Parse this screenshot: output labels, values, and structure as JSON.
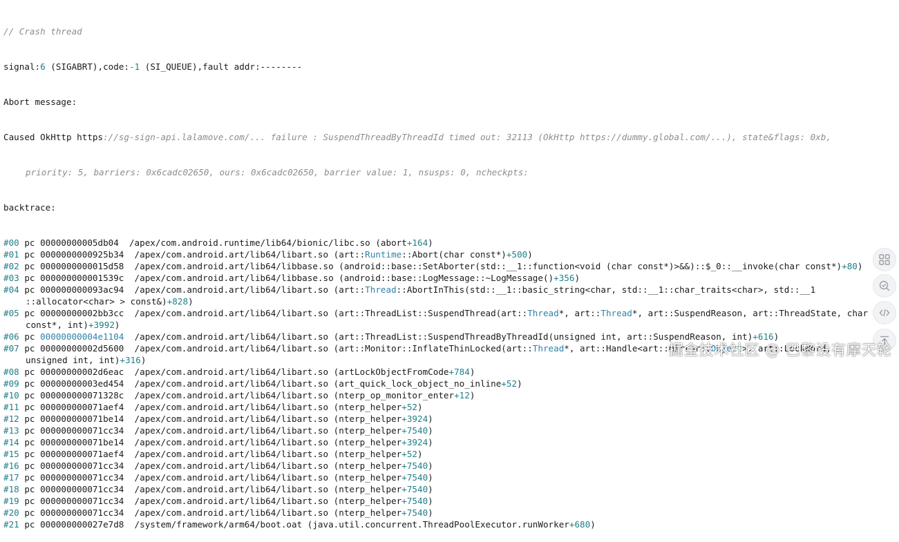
{
  "header": {
    "comment": "// Crash thread",
    "signal_prefix": "signal:",
    "signal_num": "6",
    "signal_mid": " (SIGABRT),code:",
    "code_num": "-1",
    "signal_tail": " (SI_QUEUE),fault addr:--------",
    "abort_message": "Abort message:",
    "caused_prefix": "Caused OkHttp https",
    "caused_detail_1": "://sg-sign-api.lalamove.com/... failure : SuspendThreadByThreadId timed out: 32113 (OkHttp https://dummy.global.com/...), state&flags: 0xb,",
    "caused_detail_2": "priority: 5, barriers: 0x6cadc02650, ours: 0x6cadc02650, barrier value: 1, nsusps: 0, ncheckpts:",
    "backtrace_label": "backtrace:"
  },
  "frames": [
    {
      "idx": "#00",
      "pc": " pc 00000000005db04  /apex/com.android.runtime/lib64/bionic/libc.so (abort",
      "off": "+164",
      "close": ")"
    },
    {
      "idx": "#01",
      "pc": " pc 0000000000925b34  /apex/com.android.art/lib64/libart.so (art::",
      "sym1": "Runtime",
      "mid": "::Abort(char const*)",
      "off": "+500",
      "close": ")"
    },
    {
      "idx": "#02",
      "pc": " pc 0000000000015d58  /apex/com.android.art/lib64/libbase.so (android::base::SetAborter(std::__1::function<void (char const*)>&&)::$_0::__invoke(char const*)",
      "off": "+80",
      "close": ")"
    },
    {
      "idx": "#03",
      "pc": " pc 000000000001539c  /apex/com.android.art/lib64/libbase.so (android::base::LogMessage::~LogMessage()",
      "off": "+356",
      "close": ")"
    },
    {
      "idx": "#04",
      "pc": " pc 000000000093ac94  /apex/com.android.art/lib64/libart.so (art::",
      "sym1": "Thread",
      "mid": "::AbortInThis(std::__1::basic_string<char, std::__1::char_traits<char>, std::__1",
      "cont": "::allocator<char> > const&)",
      "off": "+828",
      "close": ")"
    },
    {
      "idx": "#05",
      "pc": " pc 00000000002bb3cc  /apex/com.android.art/lib64/libart.so (art::ThreadList::SuspendThread(art::",
      "sym1": "Thread",
      "mid": "*, art::",
      "sym2": "Thread",
      "mid2": "*, art::SuspendReason, art::ThreadState, char",
      "cont": "const*, int)",
      "off": "+3992",
      "close": ")"
    },
    {
      "idx": "#06",
      "pcp": " pc ",
      "pcaddr": "00000000004e1104",
      "pc": "  /apex/com.android.art/lib64/libart.so (art::ThreadList::SuspendThreadByThreadId(unsigned int, art::SuspendReason, int)",
      "off": "+616",
      "close": ")"
    },
    {
      "idx": "#07",
      "pc": " pc 00000000002d5600  /apex/com.android.art/lib64/libart.so (art::Monitor::InflateThinLocked(art::",
      "sym1": "Thread",
      "mid": "*, art::Handle<art::mirror::",
      "sym2": "Object",
      "mid2": ">, art::LockWord,",
      "cont": "unsigned int, int)",
      "off": "+316",
      "close": ")"
    },
    {
      "idx": "#08",
      "pc": " pc 00000000002d6eac  /apex/com.android.art/lib64/libart.so (artLockObjectFromCode",
      "off": "+784",
      "close": ")"
    },
    {
      "idx": "#09",
      "pc": " pc 00000000003ed454  /apex/com.android.art/lib64/libart.so (art_quick_lock_object_no_inline",
      "off": "+52",
      "close": ")"
    },
    {
      "idx": "#10",
      "pc": " pc 000000000071328c  /apex/com.android.art/lib64/libart.so (nterp_op_monitor_enter",
      "off": "+12",
      "close": ")"
    },
    {
      "idx": "#11",
      "pc": " pc 000000000071aef4  /apex/com.android.art/lib64/libart.so (nterp_helper",
      "off": "+52",
      "close": ")"
    },
    {
      "idx": "#12",
      "pc": " pc 000000000071be14  /apex/com.android.art/lib64/libart.so (nterp_helper",
      "off": "+3924",
      "close": ")"
    },
    {
      "idx": "#13",
      "pc": " pc 000000000071cc34  /apex/com.android.art/lib64/libart.so (nterp_helper",
      "off": "+7540",
      "close": ")"
    },
    {
      "idx": "#14",
      "pc": " pc 000000000071be14  /apex/com.android.art/lib64/libart.so (nterp_helper",
      "off": "+3924",
      "close": ")"
    },
    {
      "idx": "#15",
      "pc": " pc 000000000071aef4  /apex/com.android.art/lib64/libart.so (nterp_helper",
      "off": "+52",
      "close": ")"
    },
    {
      "idx": "#16",
      "pc": " pc 000000000071cc34  /apex/com.android.art/lib64/libart.so (nterp_helper",
      "off": "+7540",
      "close": ")"
    },
    {
      "idx": "#17",
      "pc": " pc 000000000071cc34  /apex/com.android.art/lib64/libart.so (nterp_helper",
      "off": "+7540",
      "close": ")"
    },
    {
      "idx": "#18",
      "pc": " pc 000000000071cc34  /apex/com.android.art/lib64/libart.so (nterp_helper",
      "off": "+7540",
      "close": ")"
    },
    {
      "idx": "#19",
      "pc": " pc 000000000071cc34  /apex/com.android.art/lib64/libart.so (nterp_helper",
      "off": "+7540",
      "close": ")"
    },
    {
      "idx": "#20",
      "pc": " pc 000000000071cc34  /apex/com.android.art/lib64/libart.so (nterp_helper",
      "off": "+7540",
      "close": ")"
    },
    {
      "idx": "#21",
      "pc": " pc 000000000027e7d8  /system/framework/arm64/boot.oat (java.util.concurrent.ThreadPoolExecutor.runWorker",
      "off": "+680",
      "close": ")"
    }
  ],
  "watermark": "掘金技术社区 @ 巴黎没有摩天轮",
  "side_icons": [
    "grid-icon",
    "refresh-search-icon",
    "code-icon",
    "collapse-icon"
  ],
  "colors": {
    "text": "#1a1a1a",
    "comment": "#8d8d8d",
    "accent": "#1e7f86",
    "symbol": "#2d82a8"
  }
}
